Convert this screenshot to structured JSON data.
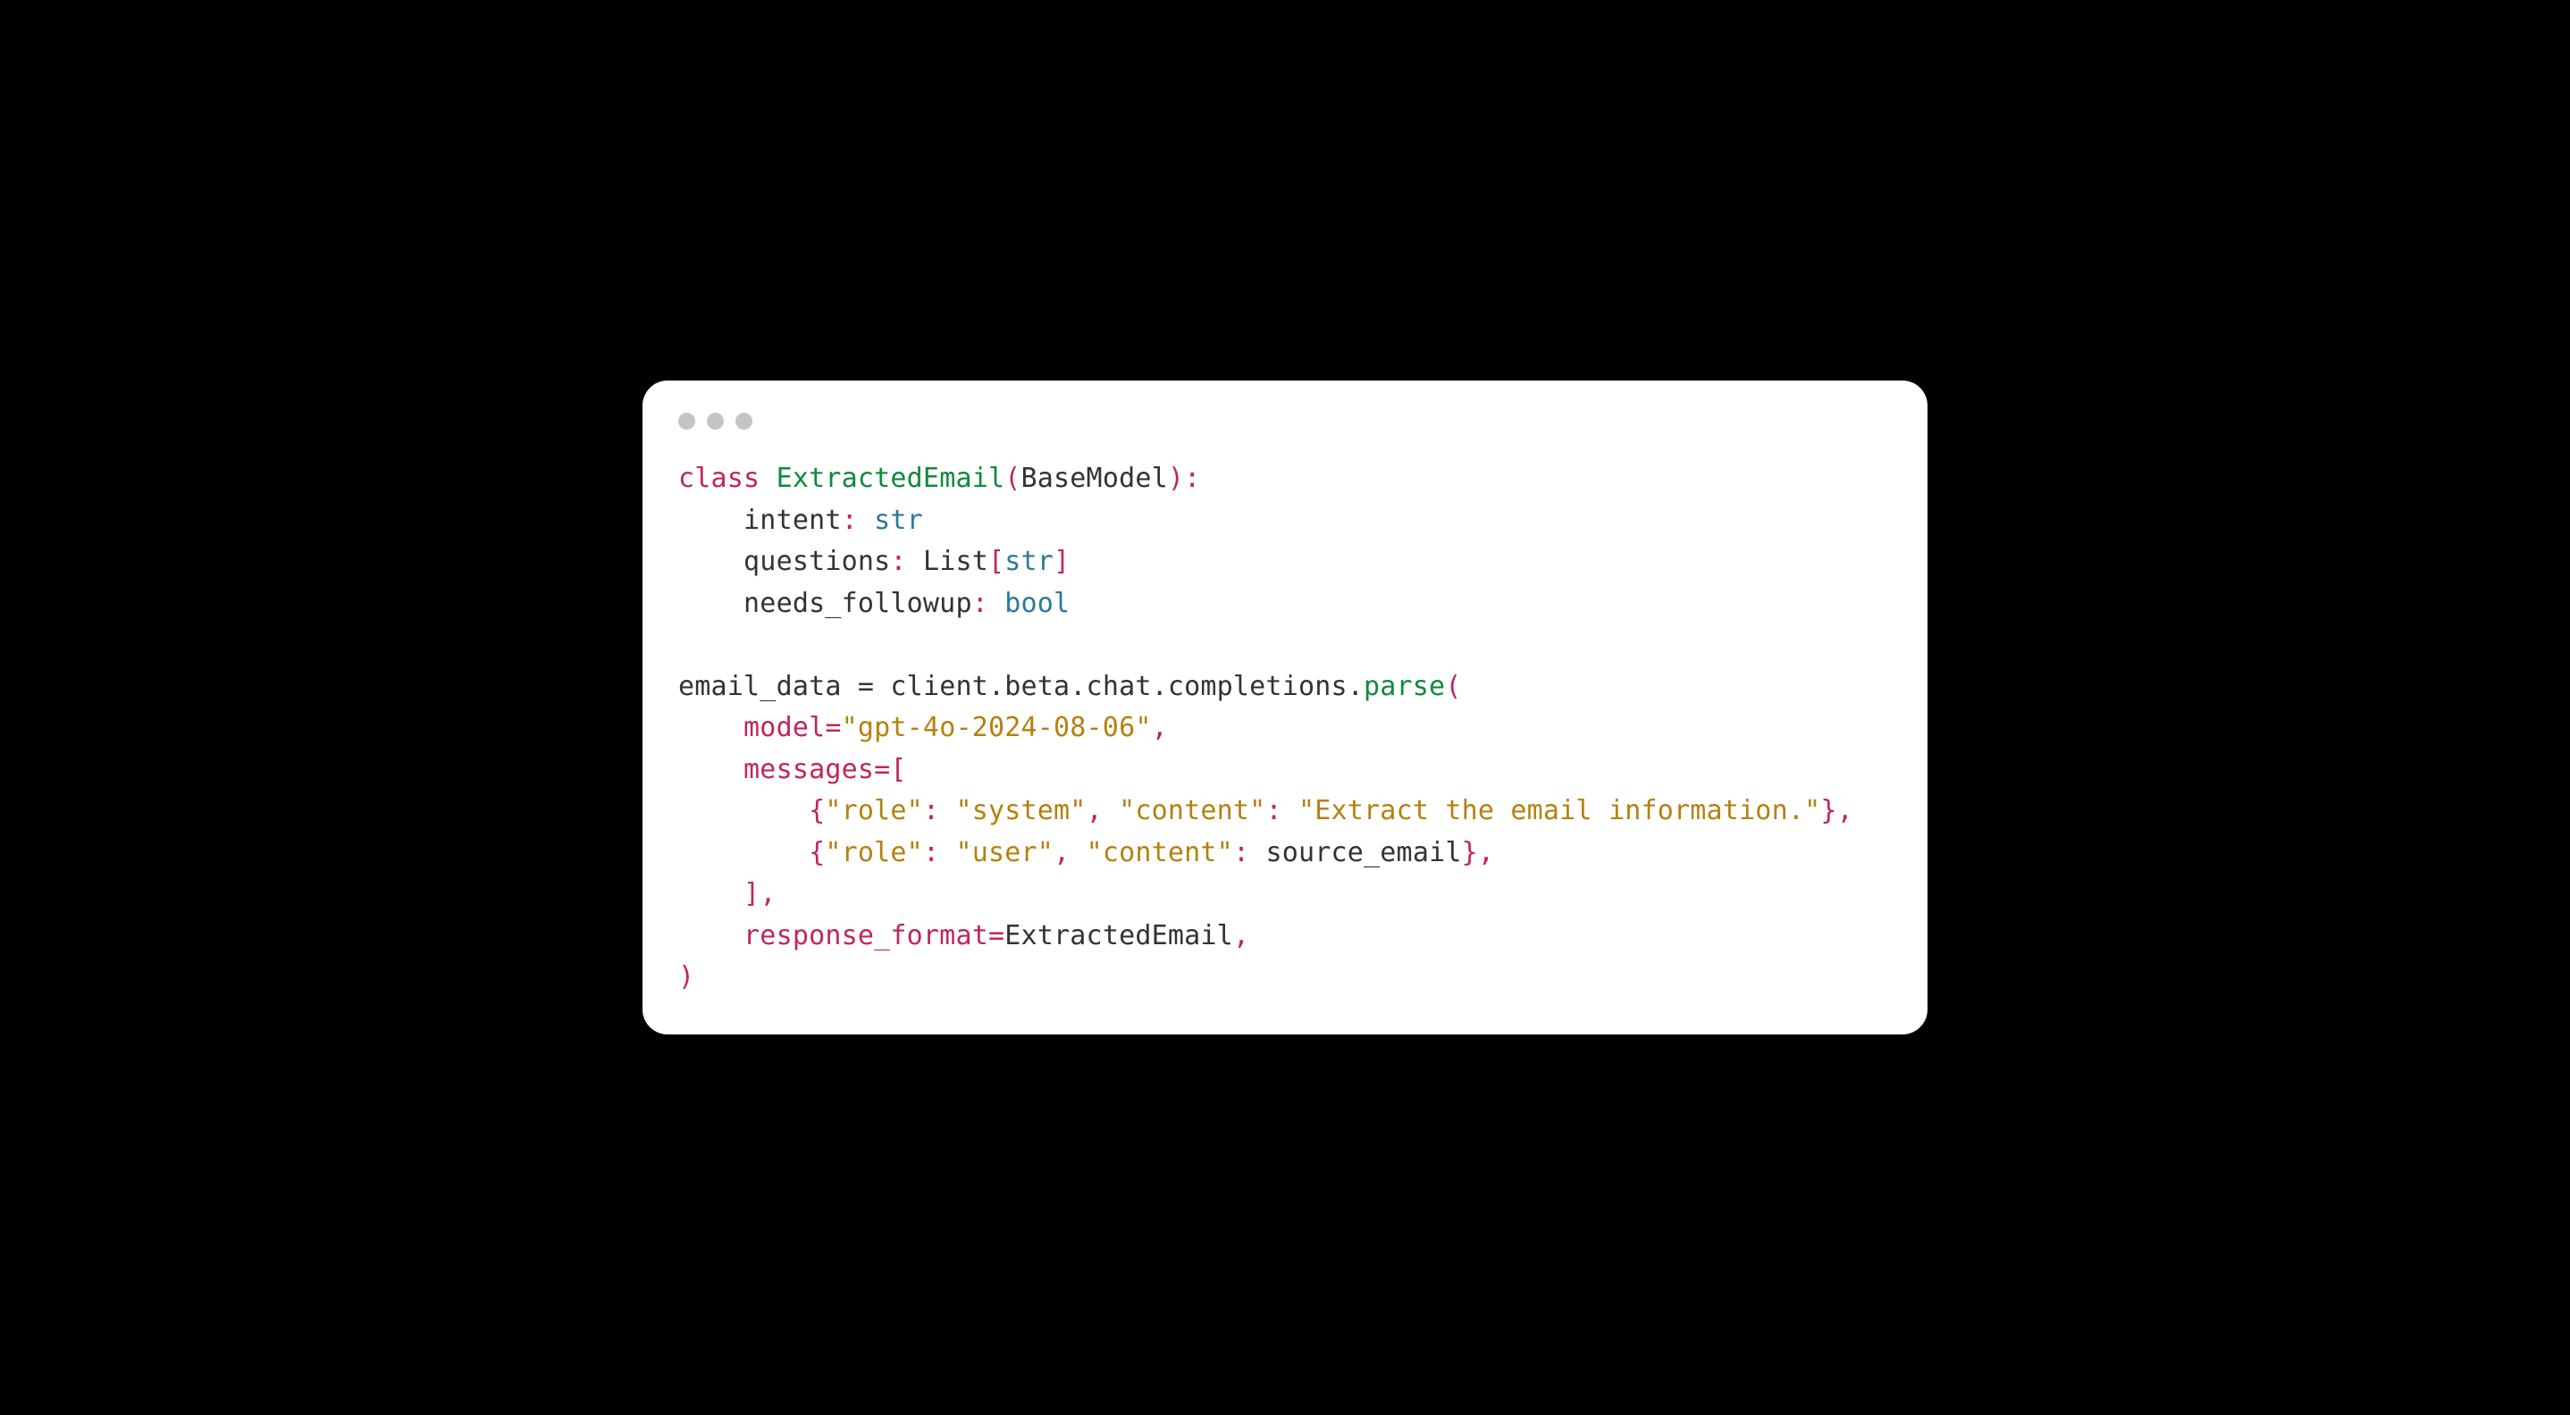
{
  "code": {
    "line1_class": "class",
    "line1_className": "ExtractedEmail",
    "line1_open": "(",
    "line1_base": "BaseModel",
    "line1_close": "):",
    "line2_field": "    intent",
    "line2_colon": ":",
    "line2_type": "str",
    "line3_field": "    questions",
    "line3_colon": ":",
    "line3_list": "List",
    "line3_open": "[",
    "line3_type": "str",
    "line3_close": "]",
    "line4_field": "    needs_followup",
    "line4_colon": ":",
    "line4_type": "bool",
    "line6_var": "email_data",
    "line6_eq": " = ",
    "line6_chain": "client.beta.chat.completions.",
    "line6_method": "parse",
    "line6_open": "(",
    "line7_indent": "    ",
    "line7_kw": "model",
    "line7_eq": "=",
    "line7_val": "\"gpt-4o-2024-08-06\"",
    "line7_comma": ",",
    "line8_indent": "    ",
    "line8_kw": "messages",
    "line8_eq": "=",
    "line8_open": "[",
    "line9_indent": "        ",
    "line9_openbrace": "{",
    "line9_k1": "\"role\"",
    "line9_colon1": ":",
    "line9_v1": "\"system\"",
    "line9_comma1": ",",
    "line9_k2": "\"content\"",
    "line9_colon2": ":",
    "line9_v2": "\"Extract the email information.\"",
    "line9_closebrace": "}",
    "line9_comma2": ",",
    "line10_indent": "        ",
    "line10_openbrace": "{",
    "line10_k1": "\"role\"",
    "line10_colon1": ":",
    "line10_v1": "\"user\"",
    "line10_comma1": ",",
    "line10_k2": "\"content\"",
    "line10_colon2": ":",
    "line10_v2": "source_email",
    "line10_closebrace": "}",
    "line10_comma2": ",",
    "line11_indent": "    ",
    "line11_close": "]",
    "line11_comma": ",",
    "line12_indent": "    ",
    "line12_kw": "response_format",
    "line12_eq": "=",
    "line12_val": "ExtractedEmail",
    "line12_comma": ",",
    "line13_close": ")"
  }
}
